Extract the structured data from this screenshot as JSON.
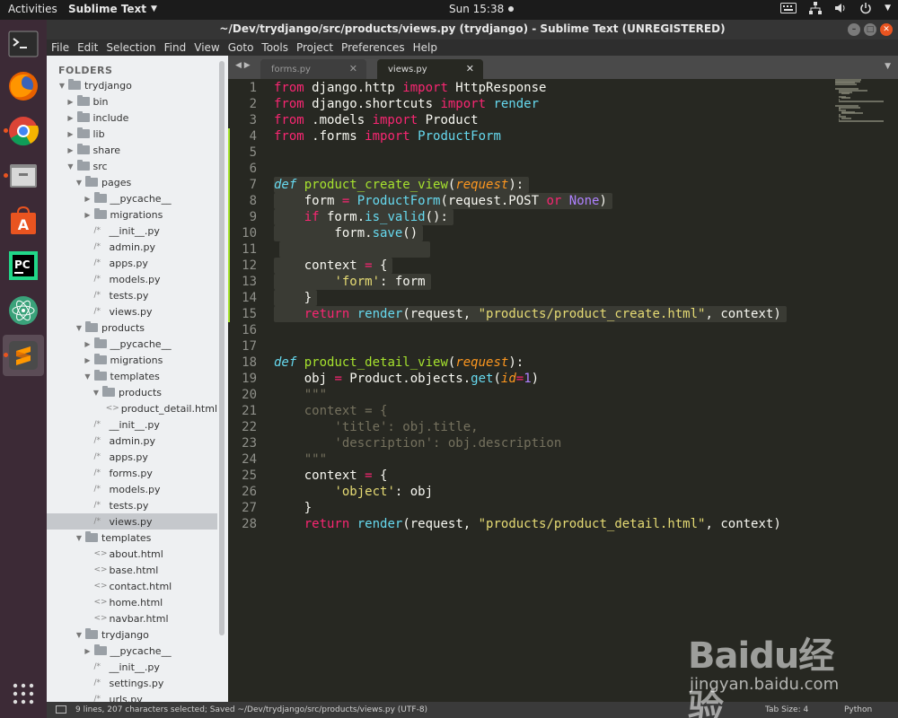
{
  "topbar": {
    "activities": "Activities",
    "app_name": "Sublime Text",
    "clock": "Sun 15:38"
  },
  "window": {
    "title": "~/Dev/trydjango/src/products/views.py (trydjango) - Sublime Text (UNREGISTERED)"
  },
  "menu": [
    "File",
    "Edit",
    "Selection",
    "Find",
    "View",
    "Goto",
    "Tools",
    "Project",
    "Preferences",
    "Help"
  ],
  "sidebar": {
    "header": "FOLDERS",
    "rows": [
      {
        "label": "trydjango",
        "type": "folder",
        "open": true,
        "depth": 0
      },
      {
        "label": "bin",
        "type": "folder",
        "open": false,
        "depth": 1
      },
      {
        "label": "include",
        "type": "folder",
        "open": false,
        "depth": 1
      },
      {
        "label": "lib",
        "type": "folder",
        "open": false,
        "depth": 1
      },
      {
        "label": "share",
        "type": "folder",
        "open": false,
        "depth": 1
      },
      {
        "label": "src",
        "type": "folder",
        "open": true,
        "depth": 1
      },
      {
        "label": "pages",
        "type": "folder",
        "open": true,
        "depth": 2
      },
      {
        "label": "__pycache__",
        "type": "folder",
        "open": false,
        "depth": 3
      },
      {
        "label": "migrations",
        "type": "folder",
        "open": false,
        "depth": 3
      },
      {
        "label": "__init__.py",
        "type": "py",
        "depth": 3
      },
      {
        "label": "admin.py",
        "type": "py",
        "depth": 3
      },
      {
        "label": "apps.py",
        "type": "py",
        "depth": 3
      },
      {
        "label": "models.py",
        "type": "py",
        "depth": 3
      },
      {
        "label": "tests.py",
        "type": "py",
        "depth": 3
      },
      {
        "label": "views.py",
        "type": "py",
        "depth": 3
      },
      {
        "label": "products",
        "type": "folder",
        "open": true,
        "depth": 2
      },
      {
        "label": "__pycache__",
        "type": "folder",
        "open": false,
        "depth": 3
      },
      {
        "label": "migrations",
        "type": "folder",
        "open": false,
        "depth": 3
      },
      {
        "label": "templates",
        "type": "folder",
        "open": true,
        "depth": 3
      },
      {
        "label": "products",
        "type": "folder",
        "open": true,
        "depth": 4
      },
      {
        "label": "product_detail.html",
        "type": "html",
        "depth": 5
      },
      {
        "label": "__init__.py",
        "type": "py",
        "depth": 3
      },
      {
        "label": "admin.py",
        "type": "py",
        "depth": 3
      },
      {
        "label": "apps.py",
        "type": "py",
        "depth": 3
      },
      {
        "label": "forms.py",
        "type": "py",
        "depth": 3
      },
      {
        "label": "models.py",
        "type": "py",
        "depth": 3
      },
      {
        "label": "tests.py",
        "type": "py",
        "depth": 3
      },
      {
        "label": "views.py",
        "type": "py",
        "depth": 3,
        "selected": true
      },
      {
        "label": "templates",
        "type": "folder",
        "open": true,
        "depth": 2
      },
      {
        "label": "about.html",
        "type": "html",
        "depth": 3
      },
      {
        "label": "base.html",
        "type": "html",
        "depth": 3
      },
      {
        "label": "contact.html",
        "type": "html",
        "depth": 3
      },
      {
        "label": "home.html",
        "type": "html",
        "depth": 3
      },
      {
        "label": "navbar.html",
        "type": "html",
        "depth": 3
      },
      {
        "label": "trydjango",
        "type": "folder",
        "open": true,
        "depth": 2
      },
      {
        "label": "__pycache__",
        "type": "folder",
        "open": false,
        "depth": 3
      },
      {
        "label": "__init__.py",
        "type": "py",
        "depth": 3
      },
      {
        "label": "settings.py",
        "type": "py",
        "depth": 3
      },
      {
        "label": "urls.py",
        "type": "py",
        "depth": 3
      }
    ]
  },
  "tabs": [
    {
      "label": "forms.py",
      "active": false
    },
    {
      "label": "views.py",
      "active": true
    }
  ],
  "editor": {
    "lines": [
      "from django.http import HttpResponse",
      "from django.shortcuts import render",
      "from .models import Product",
      "from .forms import ProductForm",
      "",
      "",
      "def product_create_view(request):",
      "    form = ProductForm(request.POST or None)",
      "    if form.is_valid():",
      "        form.save()",
      "",
      "    context = {",
      "        'form': form",
      "    }",
      "    return render(request, \"products/product_create.html\", context)",
      "",
      "",
      "def product_detail_view(request):",
      "    obj = Product.objects.get(id=1)",
      "    \"\"\"",
      "    context = {",
      "        'title': obj.title,",
      "        'description': obj.description",
      "    \"\"\"",
      "    context = {",
      "        'object': obj",
      "    }",
      "    return render(request, \"products/product_detail.html\", context)"
    ]
  },
  "statusbar": {
    "text": "9 lines, 207 characters selected; Saved ~/Dev/trydjango/src/products/views.py (UTF-8)",
    "tab_size": "Tab Size: 4",
    "syntax": "Python"
  },
  "watermark": {
    "logo": "Baidu经验",
    "url": "jingyan.baidu.com"
  }
}
